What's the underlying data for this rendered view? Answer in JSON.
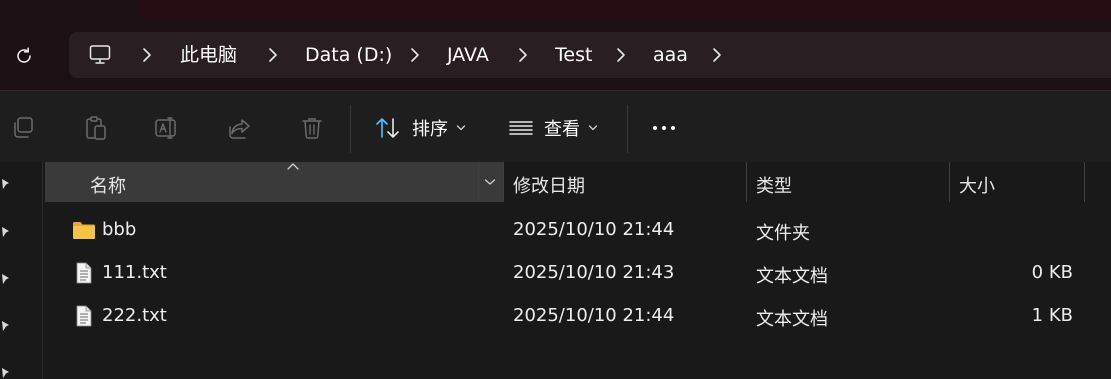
{
  "breadcrumb": {
    "items": [
      "此电脑",
      "Data (D:)",
      "JAVA",
      "Test",
      "aaa"
    ]
  },
  "toolbar": {
    "sort_label": "排序",
    "view_label": "查看",
    "more_label": "···"
  },
  "columns": {
    "name": "名称",
    "modified": "修改日期",
    "type": "类型",
    "size": "大小"
  },
  "files": [
    {
      "name": "bbb",
      "modified": "2025/10/10 21:44",
      "type": "文件夹",
      "size": "",
      "icon": "folder-icon"
    },
    {
      "name": "111.txt",
      "modified": "2025/10/10 21:43",
      "type": "文本文档",
      "size": "0 KB",
      "icon": "text-file-icon"
    },
    {
      "name": "222.txt",
      "modified": "2025/10/10 21:44",
      "type": "文本文档",
      "size": "1 KB",
      "icon": "text-file-icon"
    }
  ],
  "colors": {
    "accent": "#4cc2ff",
    "folder": "#f6c444",
    "window_tint": "#1c1014"
  }
}
